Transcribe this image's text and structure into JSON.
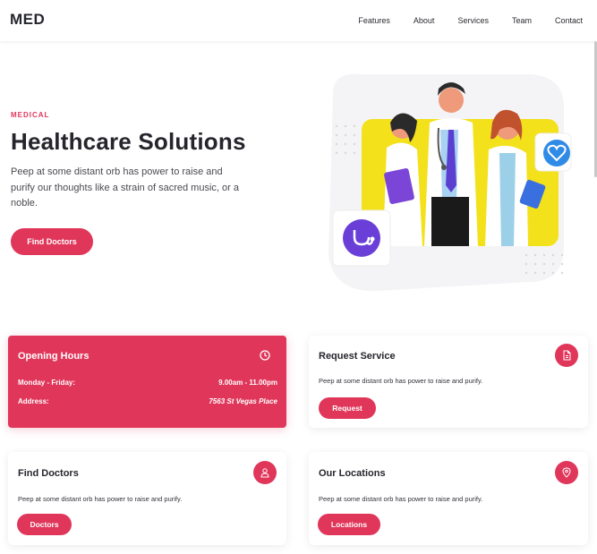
{
  "header": {
    "logo": "MED",
    "nav": [
      "Features",
      "About",
      "Services",
      "Team",
      "Contact"
    ]
  },
  "hero": {
    "eyebrow": "MEDICAL",
    "title": "Healthcare Solutions",
    "text": "Peep at some distant orb has power to raise and purify our thoughts like a strain of sacred music, or a noble.",
    "button": "Find Doctors"
  },
  "hours": {
    "title": "Opening Hours",
    "rows": [
      {
        "label": "Monday - Friday:",
        "value": "9.00am - 11.00pm"
      },
      {
        "label": "Address:",
        "value": "7563 St Vegas Place"
      }
    ]
  },
  "cards": [
    {
      "title": "Request Service",
      "text": "Peep at some distant orb has power to raise and purify.",
      "button": "Request",
      "icon": "document-icon"
    },
    {
      "title": "Find Doctors",
      "text": "Peep at some distant orb has power to raise and purify.",
      "button": "Doctors",
      "icon": "user-icon"
    },
    {
      "title": "Our Locations",
      "text": "Peep at some distant orb has power to raise and purify.",
      "button": "Locations",
      "icon": "location-pin-icon"
    }
  ],
  "colors": {
    "accent": "#e0365a",
    "yellow": "#f3e11c",
    "purple": "#6a3fd8",
    "blue": "#2f8be6"
  }
}
